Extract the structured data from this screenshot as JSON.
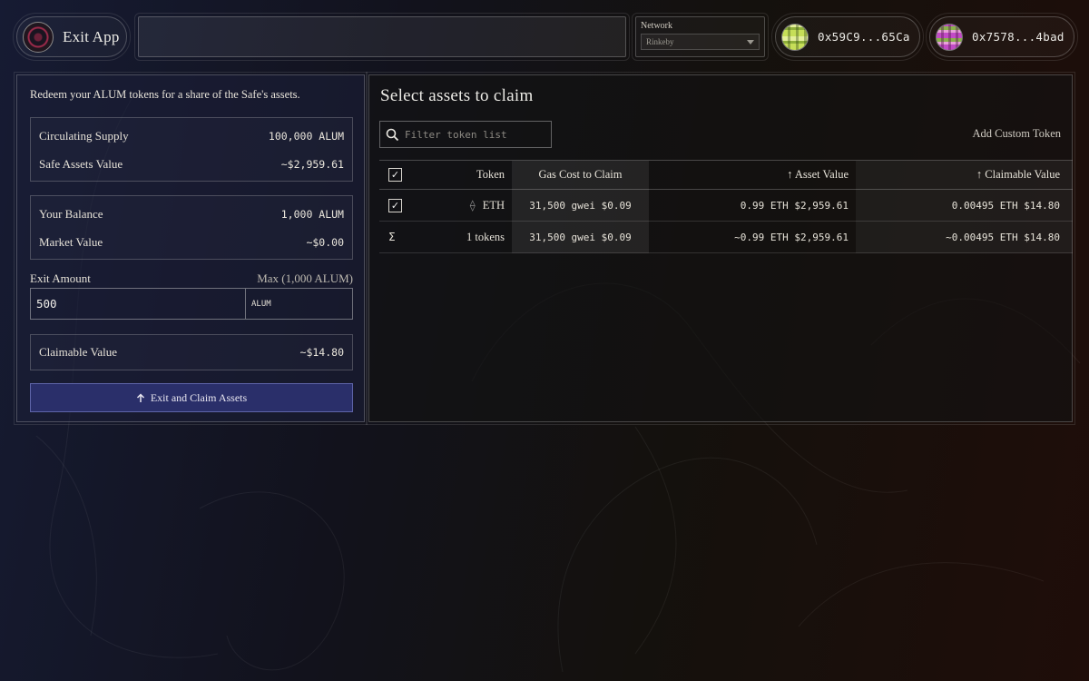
{
  "header": {
    "exit_app_label": "Exit App",
    "network": {
      "label": "Network",
      "selected": "Rinkeby"
    },
    "wallets": [
      {
        "address": "0x59C9...65Ca"
      },
      {
        "address": "0x7578...4bad"
      }
    ]
  },
  "left_panel": {
    "intro": "Redeem your ALUM tokens for a share of the Safe's assets.",
    "supply": {
      "circulating_label": "Circulating Supply",
      "circulating_value": "100,000 ALUM",
      "safe_assets_label": "Safe Assets Value",
      "safe_assets_value": "~$2,959.61"
    },
    "balance": {
      "your_balance_label": "Your Balance",
      "your_balance_value": "1,000 ALUM",
      "market_value_label": "Market Value",
      "market_value_value": "~$0.00"
    },
    "exit": {
      "label": "Exit Amount",
      "max_label": "Max (1,000 ALUM)",
      "value": "500",
      "unit": "ALUM"
    },
    "claimable": {
      "label": "Claimable Value",
      "value": "~$14.80"
    },
    "claim_button": "Exit and Claim Assets"
  },
  "right_panel": {
    "title": "Select assets to claim",
    "filter_placeholder": "Filter token list",
    "add_custom_label": "Add Custom Token",
    "columns": {
      "token": "Token",
      "gas": "Gas Cost to Claim",
      "asset_value": "Asset Value",
      "claimable_value": "Claimable Value"
    },
    "rows": [
      {
        "checked": true,
        "token": "ETH",
        "icon": "ethereum-icon",
        "gas": "31,500 gwei $0.09",
        "asset_value": "0.99 ETH $2,959.61",
        "claimable_value": "0.00495 ETH $14.80"
      }
    ],
    "totals": {
      "symbol": "Σ",
      "token": "1 tokens",
      "gas": "31,500 gwei $0.09",
      "asset_value": "~0.99 ETH $2,959.61",
      "claimable_value": "~0.00495 ETH $14.80"
    }
  },
  "colors": {
    "accent_button": "#2a2f6a",
    "accent_button_border": "#5e64a8"
  }
}
